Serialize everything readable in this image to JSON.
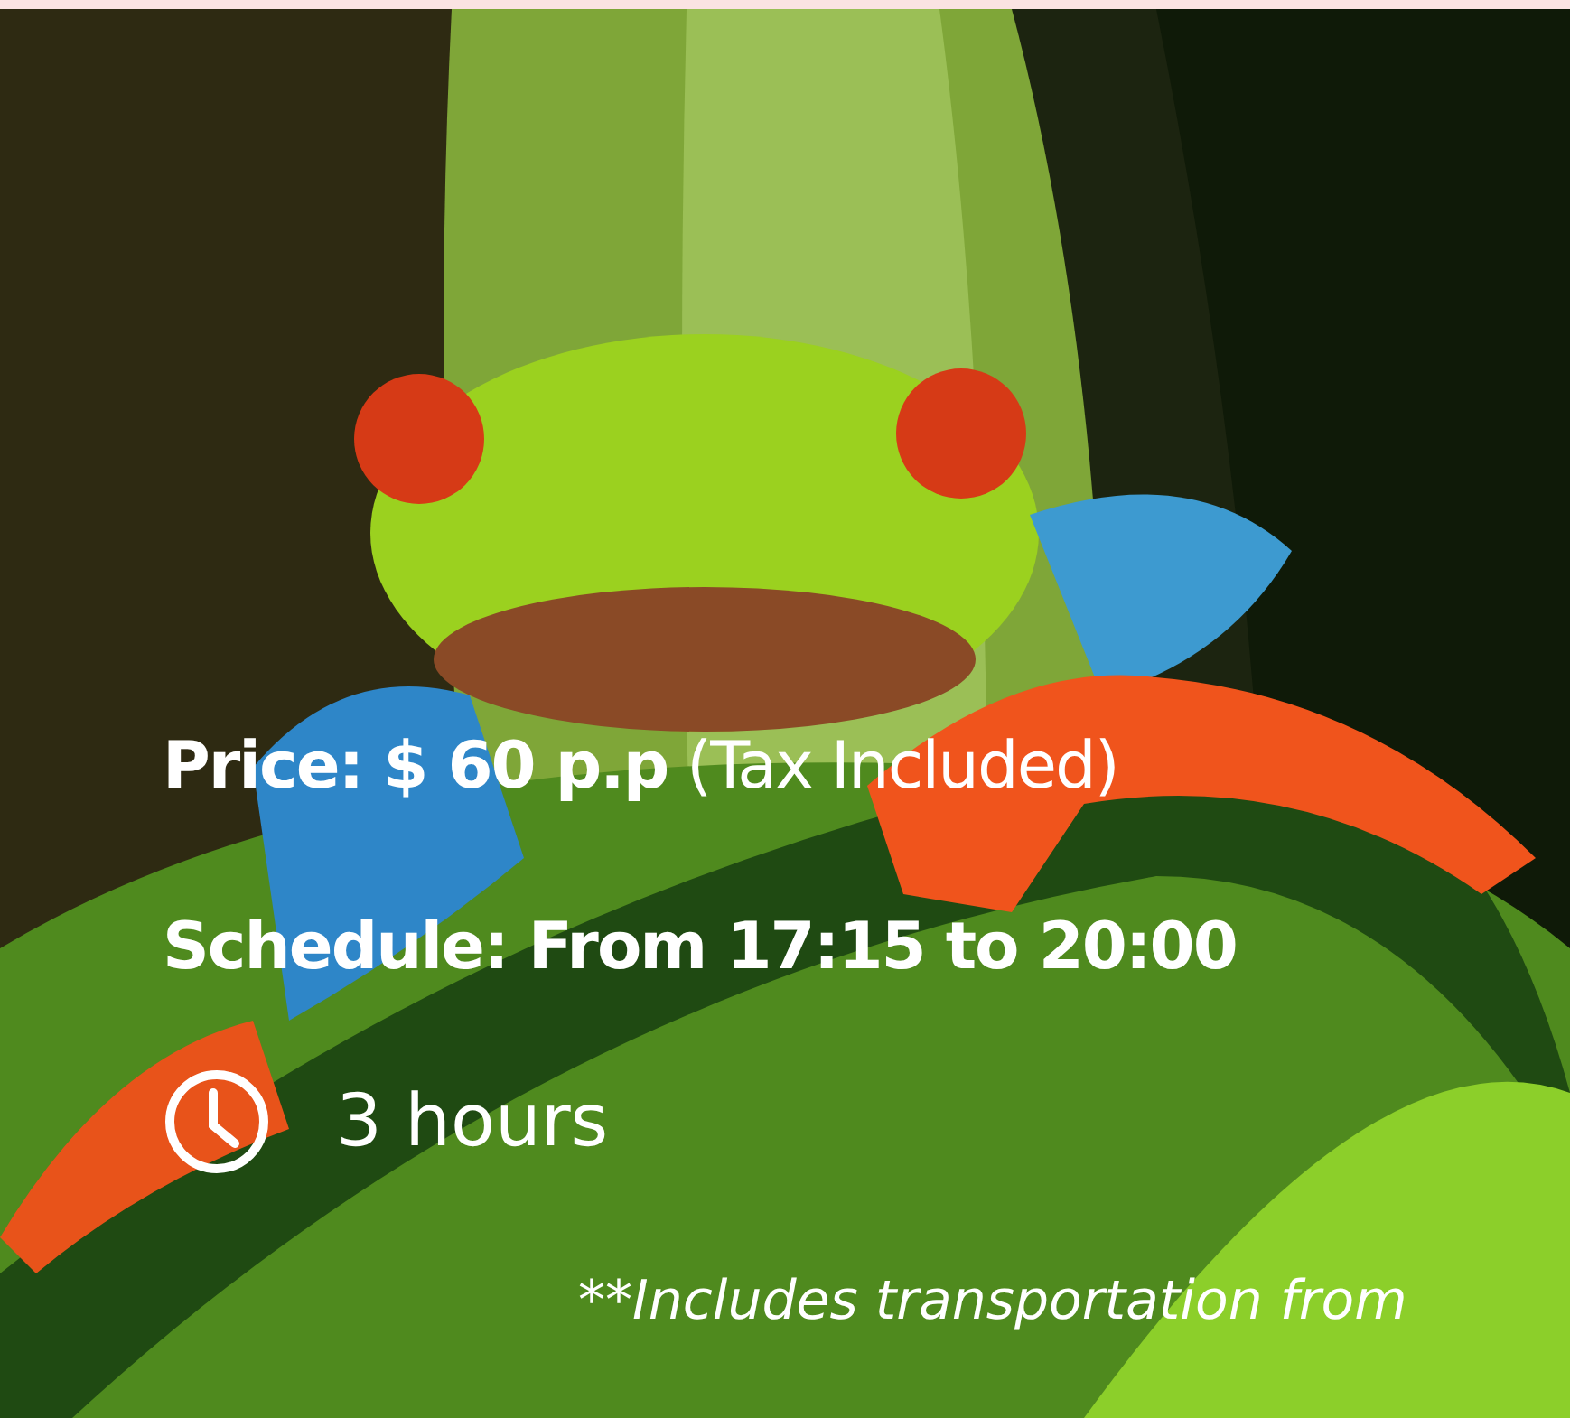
{
  "price": "**Price: $ 60  p.p** (Tax Included)",
  "schedule": "Schedule: From 17:15 to 20:00",
  "duration": "3 hours",
  "note": "**Includes transportation from"
}
